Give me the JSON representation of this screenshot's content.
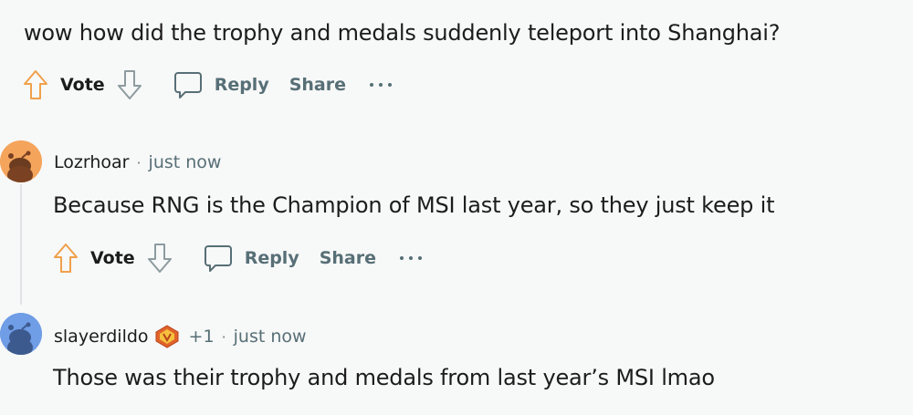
{
  "comments": [
    {
      "text": "wow how did the trophy and medals suddenly teleport into Shanghai?",
      "actions": {
        "vote_label": "Vote",
        "reply_label": "Reply",
        "share_label": "Share"
      }
    },
    {
      "username": "Lozrhoar",
      "timestamp": "just now",
      "text": "Because RNG is the Champion of MSI last year, so they just keep it",
      "actions": {
        "vote_label": "Vote",
        "reply_label": "Reply",
        "share_label": "Share"
      },
      "avatar_color": "#f5a45c"
    },
    {
      "username": "slayerdildo",
      "karma": "+1",
      "timestamp": "just now",
      "text": "Those was their trophy and medals from last year’s MSI lmao",
      "avatar_color": "#6f9de6"
    }
  ],
  "separator": "·",
  "colors": {
    "background": "#f7f8f8",
    "text": "#1c1c1c",
    "muted": "#576f76",
    "icon": "#8d9b9f"
  }
}
